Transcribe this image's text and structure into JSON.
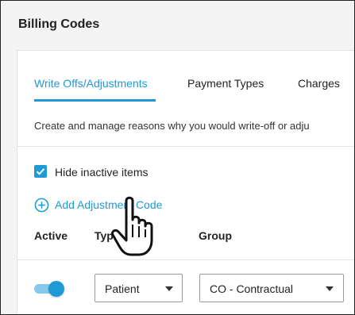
{
  "page": {
    "title": "Billing Codes"
  },
  "tabs": [
    {
      "label": "Write Offs/Adjustments",
      "active": true
    },
    {
      "label": "Payment Types",
      "active": false
    },
    {
      "label": "Charges",
      "active": false
    }
  ],
  "description": "Create and manage reasons why you would write-off or adju",
  "hide_inactive": {
    "label": "Hide inactive items",
    "checked": true
  },
  "add_code": {
    "label": "Add Adjustment Code"
  },
  "table": {
    "columns": [
      "Active",
      "Type",
      "Group"
    ],
    "rows": [
      {
        "active": true,
        "type": "Patient",
        "group": "CO - Contractual"
      }
    ]
  },
  "colors": {
    "accent": "#1e9ad6",
    "toggle_track": "#86c9ec",
    "background": "#f4f4f5"
  },
  "icons": {
    "checkbox": "check-icon",
    "add": "plus-circle-icon",
    "cursor": "hand-pointer-icon",
    "select": "caret-down-icon"
  }
}
